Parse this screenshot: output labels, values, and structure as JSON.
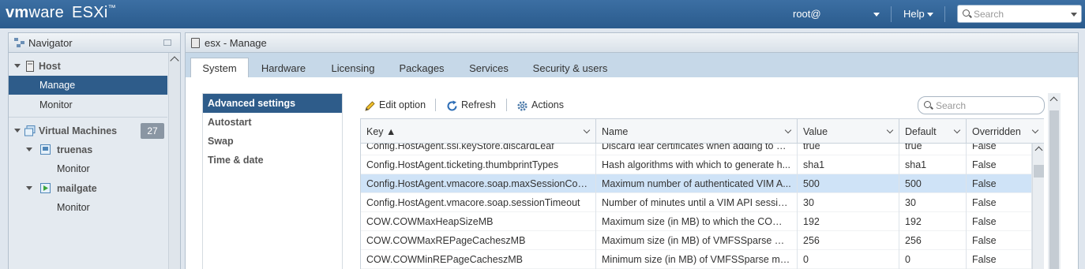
{
  "app": {
    "brand_vm": "vm",
    "brand_ware": "ware",
    "brand_product": "ESXi",
    "brand_tm": "™"
  },
  "topbar": {
    "user": "root@",
    "help": "Help",
    "search_placeholder": "Search"
  },
  "navigator": {
    "title": "Navigator",
    "items": [
      {
        "label": "Host"
      },
      {
        "label": "Manage"
      },
      {
        "label": "Monitor"
      },
      {
        "label": "Virtual Machines",
        "count": "27"
      },
      {
        "label": "truenas"
      },
      {
        "label": "Monitor"
      },
      {
        "label": "mailgate"
      },
      {
        "label": "Monitor"
      }
    ]
  },
  "panel": {
    "title": "esx - Manage",
    "tabs": [
      "System",
      "Hardware",
      "Licensing",
      "Packages",
      "Services",
      "Security & users"
    ],
    "active_tab": "System"
  },
  "sidemenu": [
    "Advanced settings",
    "Autostart",
    "Swap",
    "Time & date"
  ],
  "toolbar": {
    "edit": "Edit option",
    "refresh": "Refresh",
    "actions": "Actions",
    "search_placeholder": "Search"
  },
  "grid": {
    "columns": [
      "Key ▲",
      "Name",
      "Value",
      "Default",
      "Overridden"
    ],
    "rows": [
      [
        "Config.HostAgent.ssl.keyStore.discardLeaf",
        "Discard leaf certificates when adding to C...",
        "true",
        "true",
        "False"
      ],
      [
        "Config.HostAgent.ticketing.thumbprintTypes",
        "Hash algorithms with which to generate h...",
        "sha1",
        "sha1",
        "False"
      ],
      [
        "Config.HostAgent.vmacore.soap.maxSessionCount",
        "Maximum number of authenticated VIM A...",
        "500",
        "500",
        "False"
      ],
      [
        "Config.HostAgent.vmacore.soap.sessionTimeout",
        "Number of minutes until a VIM API sessio...",
        "30",
        "30",
        "False"
      ],
      [
        "COW.COWMaxHeapSizeMB",
        "Maximum size (in MB) to which the COW ...",
        "192",
        "192",
        "False"
      ],
      [
        "COW.COWMaxREPageCacheszMB",
        "Maximum size (in MB) of VMFSSparse me...",
        "256",
        "256",
        "False"
      ],
      [
        "COW.COWMinREPageCacheszMB",
        "Minimum size (in MB) of VMFSSparse met...",
        "0",
        "0",
        "False"
      ]
    ],
    "selected_row": 2
  },
  "colors": {
    "topbar": "#2f6398",
    "selection": "#2e5c8a",
    "row_selected": "#cfe3f7",
    "tab_strip": "#c6d8e8"
  },
  "icons": [
    "search-icon",
    "host-icon",
    "vm-group-icon",
    "vm-icon",
    "vm-running-icon",
    "pencil-icon",
    "refresh-icon",
    "gear-icon"
  ]
}
